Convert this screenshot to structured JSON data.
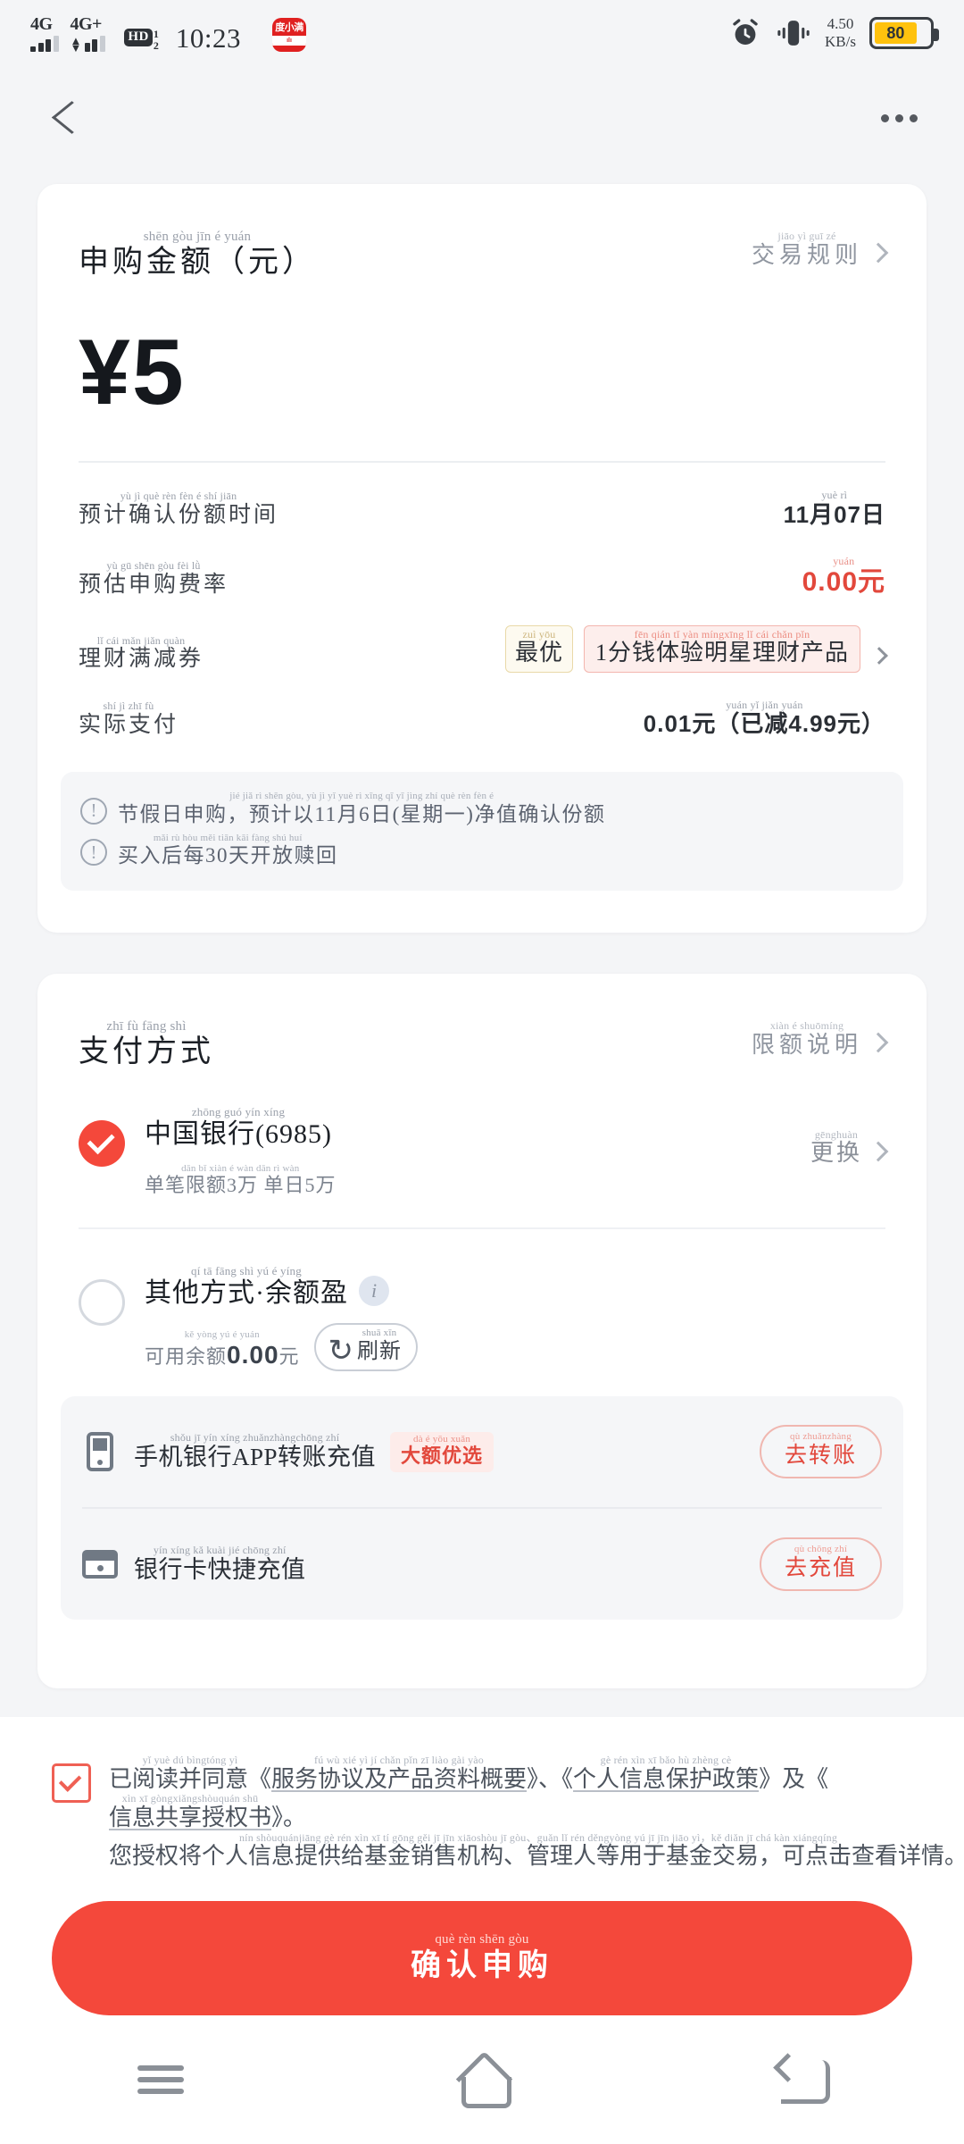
{
  "status_bar": {
    "network_1": "4G",
    "network_2": "4G+",
    "hd_label": "HD",
    "sim_1": "1",
    "sim_2": "2",
    "time": "10:23",
    "app_icon_text": "度小满",
    "app_icon_sub": "ılı",
    "net_speed_value": "4.50",
    "net_speed_unit": "KB/s",
    "battery_percent": "80"
  },
  "nav": {
    "back": "back-arrow",
    "more": "more-options"
  },
  "amount_card": {
    "title_py": "shēn gòu jīn é    yuán",
    "title": "申购金额（元）",
    "rule_link_py": "jiāo yì guī zé",
    "rule_link": "交易规则",
    "amount": "¥5",
    "rows": [
      {
        "label_py": "yù jì què rèn fèn é shí jiān",
        "label": "预计确认份额时间",
        "value_py": "yuè        rì",
        "value": "11月07日"
      },
      {
        "label_py": "yù gū shēn gòu fèi lǜ",
        "label": "预估申购费率",
        "value_py": "yuán",
        "value": "0.00元"
      },
      {
        "label_py": "lǐ cái mǎn jiǎn quàn",
        "label": "理财满减券",
        "badge_best_py": "zuì yōu",
        "badge_best": "最优",
        "badge_coupon_py": "fēn qián tǐ yàn míngxīng lǐ cái chǎn pǐn",
        "badge_coupon": "1分钱体验明星理财产品"
      },
      {
        "label_py": "shí jì zhī fù",
        "label": "实际支付",
        "value_py": "yuán   yǐ jiǎn        yuán",
        "value": "0.01元（已减4.99元）"
      }
    ],
    "notes": [
      {
        "py": "jié jiǎ rì shēn gòu,  yù jì yǐ   yuè  rì xīng qī yī  jìng zhí què rèn fèn é",
        "text": "节假日申购，预计以11月6日(星期一)净值确认份额"
      },
      {
        "py": "mǎi rù hòu měi    tiān kāi fàng shú huí",
        "text": "买入后每30天开放赎回"
      }
    ]
  },
  "payment_card": {
    "title_py": "zhī fù fāng shì",
    "title": "支付方式",
    "limit_link_py": "xiàn é shuōmíng",
    "limit_link": "限额说明",
    "options": [
      {
        "selected": true,
        "name_py": "zhōng guó yín xíng",
        "name": "中国银行(6985)",
        "sub_py": "dān bǐ xiàn é   wàn dān rì   wàn",
        "sub": "单笔限额3万 单日5万",
        "action_py": "gēnghuàn",
        "action": "更换"
      },
      {
        "selected": false,
        "name_py": "qí tā fāng shì   yú é yíng",
        "name": "其他方式·余额盈",
        "sub_py": "kě yòng yú é            yuán",
        "sub_prefix": "可用余额",
        "sub_amount": "0.00",
        "sub_suffix": "元",
        "refresh_py": "shuā xīn",
        "refresh": "刷新"
      }
    ],
    "recharge_rows": [
      {
        "icon": "phone-icon",
        "label_py": "shǒu jī yín xíng       zhuǎnzhàngchōng zhí",
        "label": "手机银行APP转账充值",
        "tag_py": "dà é yōu xuǎn",
        "tag": "大额优选",
        "button_py": "qù zhuǎnzhàng",
        "button": "去转账"
      },
      {
        "icon": "card-icon",
        "label_py": "yín xíng kǎ kuài jié chōng zhí",
        "label": "银行卡快捷充值",
        "tag": "",
        "button_py": "qù chōng zhí",
        "button": "去充值"
      }
    ]
  },
  "bottom": {
    "agreement": {
      "checked": true,
      "seg1_py": "yǐ yuè dú bìngtóng yì",
      "seg1": "已阅读并同意《",
      "seg2_py": "fú wù xié yì jí chǎn pǐn zī liào gài yào",
      "seg2": "服务协议及产品资料概要",
      "seg3": "》、《",
      "seg4_py": "gè rén xìn xī bǎo hù zhèng cè",
      "seg4": "个人信息保护政策",
      "seg5": "》及《",
      "seg6_py": "xìn xī gòngxiǎngshòuquán shū",
      "seg6": "信息共享授权书",
      "seg7": "》。",
      "seg8_py": "nín shòuquánjiāng gè rén xìn xī tí gōng gěi jī jīn xiāoshòu jī gòu、guǎn lǐ rén děngyòng yú jī jīn jiāo yì，kě diǎn jī chá kàn xiángqíng",
      "seg8": "您授权将个人信息提供给基金销售机构、管理人等用于基金交易，可点击查看详情。"
    },
    "confirm_py": "què rèn shēn gòu",
    "confirm": "确认申购"
  },
  "android_nav": {
    "menu": "menu-button",
    "home": "home-button",
    "back": "back-button"
  },
  "colors": {
    "accent_red": "#f4483b",
    "price_red": "#e2483c",
    "page_bg": "#f4f5f7",
    "card_bg": "#ffffff",
    "battery_yellow": "#ffc20e"
  }
}
